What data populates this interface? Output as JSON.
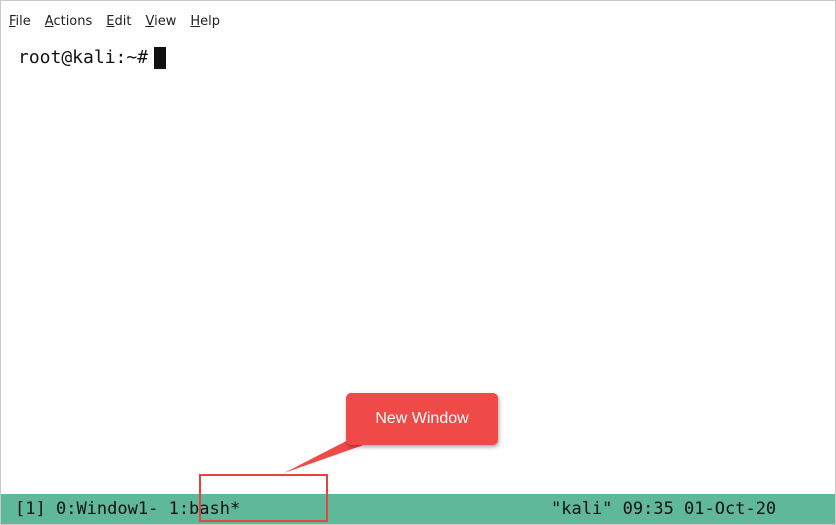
{
  "menu": {
    "items": [
      {
        "mnemonic": "F",
        "rest": "ile"
      },
      {
        "mnemonic": "A",
        "rest": "ctions"
      },
      {
        "mnemonic": "E",
        "rest": "dit"
      },
      {
        "mnemonic": "V",
        "rest": "iew"
      },
      {
        "mnemonic": "H",
        "rest": "elp"
      }
    ]
  },
  "terminal": {
    "prompt": "root@kali:~#"
  },
  "statusbar": {
    "session": "[1]",
    "window0": "0:Window1-",
    "window1": "1:bash*",
    "right": "\"kali\" 09:35 01-Oct-20"
  },
  "annotation": {
    "callout_text": "New Window",
    "color": "#f04a48"
  },
  "colors": {
    "statusbar_bg": "#5fb89a",
    "terminal_bg": "#ffffff",
    "text": "#111111"
  }
}
